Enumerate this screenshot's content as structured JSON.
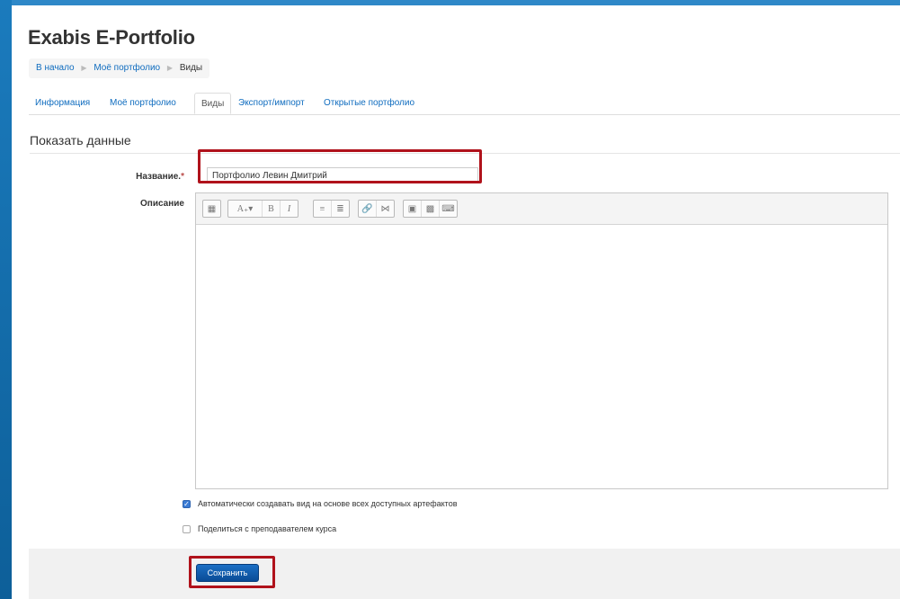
{
  "site": {
    "title": "Exabis E-Portfolio"
  },
  "breadcrumb": [
    "В начало",
    "Моё портфолио",
    "Виды"
  ],
  "tabs": [
    "Информация",
    "Моё портфолио",
    "Виды",
    "Экспорт/импорт",
    "Открытые портфолио"
  ],
  "active_tab": "Виды",
  "form": {
    "legend": "Показать данные",
    "name_label": "Название.",
    "required_mark": "*",
    "name_value": "Портфолио Левин Дмитрий",
    "description_label": "Описание",
    "checkbox_auto_label": "Автоматически создавать вид на основе всех доступных артефактов",
    "checkbox_auto_checked": true,
    "checkbox_share_label": "Поделиться с преподавателем курса",
    "checkbox_share_checked": false,
    "save_label": "Сохранить"
  },
  "editor_toolbar": [
    [
      "table-icon"
    ],
    [
      "font-size-icon",
      "bold-icon",
      "italic-icon"
    ],
    [
      "bullet-list-icon",
      "numbered-list-icon"
    ],
    [
      "link-icon",
      "unlink-icon"
    ],
    [
      "image-icon",
      "media-icon",
      "clipboard-icon"
    ]
  ],
  "colors": {
    "accent": "#0f6cbf",
    "highlight": "#b0121b",
    "frame": "#0f6cad",
    "save_button": "#0a4b96"
  }
}
